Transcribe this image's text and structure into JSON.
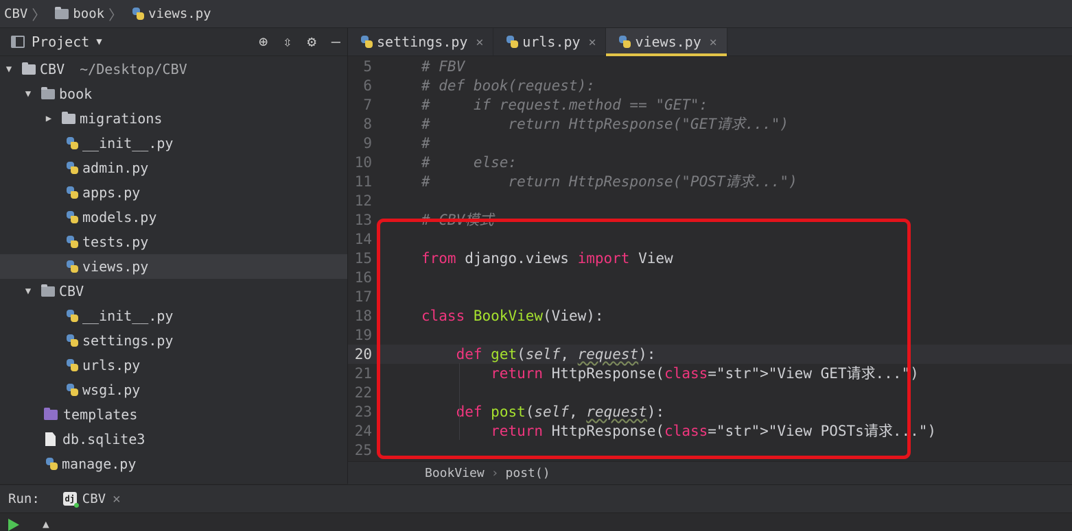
{
  "breadcrumb": [
    "CBV",
    "book",
    "views.py"
  ],
  "project_panel": {
    "title": "Project",
    "tree": [
      {
        "label": "CBV",
        "suffix": "~/Desktop/CBV",
        "type": "folder",
        "expanded": true,
        "depth": 0
      },
      {
        "label": "book",
        "type": "package",
        "expanded": true,
        "depth": 1
      },
      {
        "label": "migrations",
        "type": "folder",
        "expanded": false,
        "depth": 2
      },
      {
        "label": "__init__.py",
        "type": "py",
        "depth": 3
      },
      {
        "label": "admin.py",
        "type": "py",
        "depth": 3
      },
      {
        "label": "apps.py",
        "type": "py",
        "depth": 3
      },
      {
        "label": "models.py",
        "type": "py",
        "depth": 3
      },
      {
        "label": "tests.py",
        "type": "py",
        "depth": 3
      },
      {
        "label": "views.py",
        "type": "py",
        "depth": 3,
        "selected": true
      },
      {
        "label": "CBV",
        "type": "package",
        "expanded": true,
        "depth": 1
      },
      {
        "label": "__init__.py",
        "type": "py",
        "depth": 3
      },
      {
        "label": "settings.py",
        "type": "py",
        "depth": 3
      },
      {
        "label": "urls.py",
        "type": "py",
        "depth": 3
      },
      {
        "label": "wsgi.py",
        "type": "py",
        "depth": 3
      },
      {
        "label": "templates",
        "type": "templates",
        "depth": 2
      },
      {
        "label": "db.sqlite3",
        "type": "file",
        "depth": 2
      },
      {
        "label": "manage.py",
        "type": "py",
        "depth": 2
      }
    ]
  },
  "tabs": [
    {
      "label": "settings.py",
      "active": false
    },
    {
      "label": "urls.py",
      "active": false
    },
    {
      "label": "views.py",
      "active": true
    }
  ],
  "editor": {
    "current_line": 20,
    "lines": [
      {
        "n": "5",
        "text": "# FBV"
      },
      {
        "n": "6",
        "text": "# def book(request):"
      },
      {
        "n": "7",
        "text": "#     if request.method == \"GET\":"
      },
      {
        "n": "8",
        "text": "#         return HttpResponse(\"GET请求...\")"
      },
      {
        "n": "9",
        "text": "#"
      },
      {
        "n": "10",
        "text": "#     else:"
      },
      {
        "n": "11",
        "text": "#         return HttpResponse(\"POST请求...\")"
      },
      {
        "n": "12",
        "text": ""
      },
      {
        "n": "13",
        "text": "# CBV模式"
      },
      {
        "n": "14",
        "text": ""
      },
      {
        "n": "15",
        "text": "from django.views import View"
      },
      {
        "n": "16",
        "text": ""
      },
      {
        "n": "17",
        "text": ""
      },
      {
        "n": "18",
        "text": "class BookView(View):"
      },
      {
        "n": "19",
        "text": ""
      },
      {
        "n": "20",
        "text": "    def get(self, request):"
      },
      {
        "n": "21",
        "text": "        return HttpResponse(\"View GET请求...\")"
      },
      {
        "n": "22",
        "text": ""
      },
      {
        "n": "23",
        "text": "    def post(self, request):"
      },
      {
        "n": "24",
        "text": "        return HttpResponse(\"View POSTs请求...\")"
      },
      {
        "n": "25",
        "text": ""
      }
    ]
  },
  "code_crumbs": [
    "BookView",
    "post()"
  ],
  "run": {
    "label": "Run:",
    "config": "CBV"
  },
  "colors": {
    "accent_tab": "#e3c448",
    "highlight_box": "#e4131b",
    "keyword": "#f0367e",
    "class_name": "#a6e22e",
    "string": "#f1d36b"
  }
}
